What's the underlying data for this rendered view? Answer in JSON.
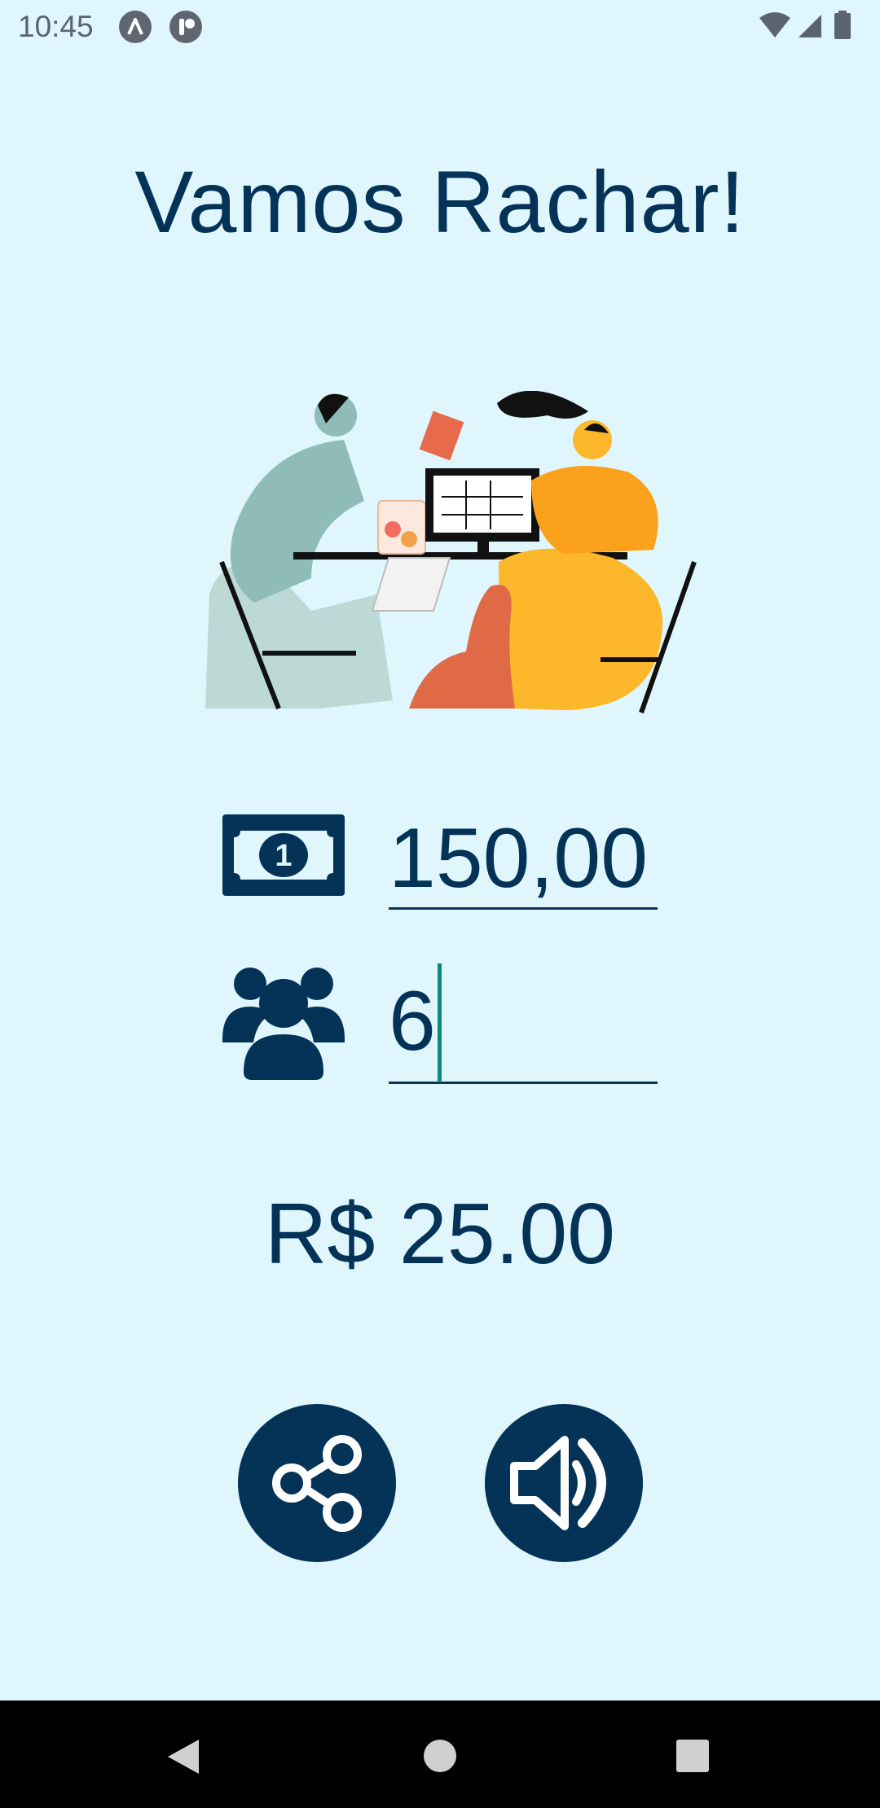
{
  "status_bar": {
    "time": "10:45",
    "icons": [
      "android-notification-icon",
      "app-notification-icon",
      "wifi-icon",
      "signal-icon",
      "battery-icon"
    ]
  },
  "app": {
    "title": "Vamos Rachar!"
  },
  "illustration": {
    "semantic": "people-splitting-bill-illustration"
  },
  "form": {
    "amount": {
      "value": "150,00",
      "icon": "money-bill-icon"
    },
    "people": {
      "value": "6",
      "icon": "people-group-icon"
    }
  },
  "result": {
    "text": "R$ 25.00"
  },
  "actions": {
    "share": {
      "icon": "share-icon"
    },
    "speak": {
      "icon": "speaker-icon"
    }
  },
  "navigation": {
    "buttons": [
      "back-icon",
      "home-icon",
      "recents-icon"
    ]
  },
  "colors": {
    "background": "#dff6fc",
    "primary": "#053357",
    "cursor": "#0b8a7a"
  }
}
